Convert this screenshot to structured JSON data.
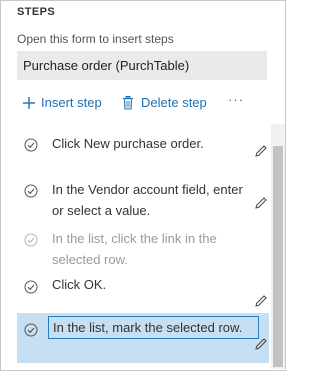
{
  "header": {
    "title": "STEPS"
  },
  "form": {
    "label": "Open this form to insert steps",
    "value": "Purchase order (PurchTable)"
  },
  "toolbar": {
    "insert_label": "Insert step",
    "delete_label": "Delete step",
    "more_label": "···"
  },
  "steps": [
    {
      "text": "Click New purchase order."
    },
    {
      "text": "In the Vendor account field, enter or select a value."
    },
    {
      "text": "In the list, click the link in the selected row."
    },
    {
      "text": "Click OK."
    },
    {
      "text": "In the list, mark the selected row."
    }
  ],
  "colors": {
    "accent": "#1f6fb5",
    "selection": "#c7dff2",
    "field_bg": "#eaeaea"
  }
}
